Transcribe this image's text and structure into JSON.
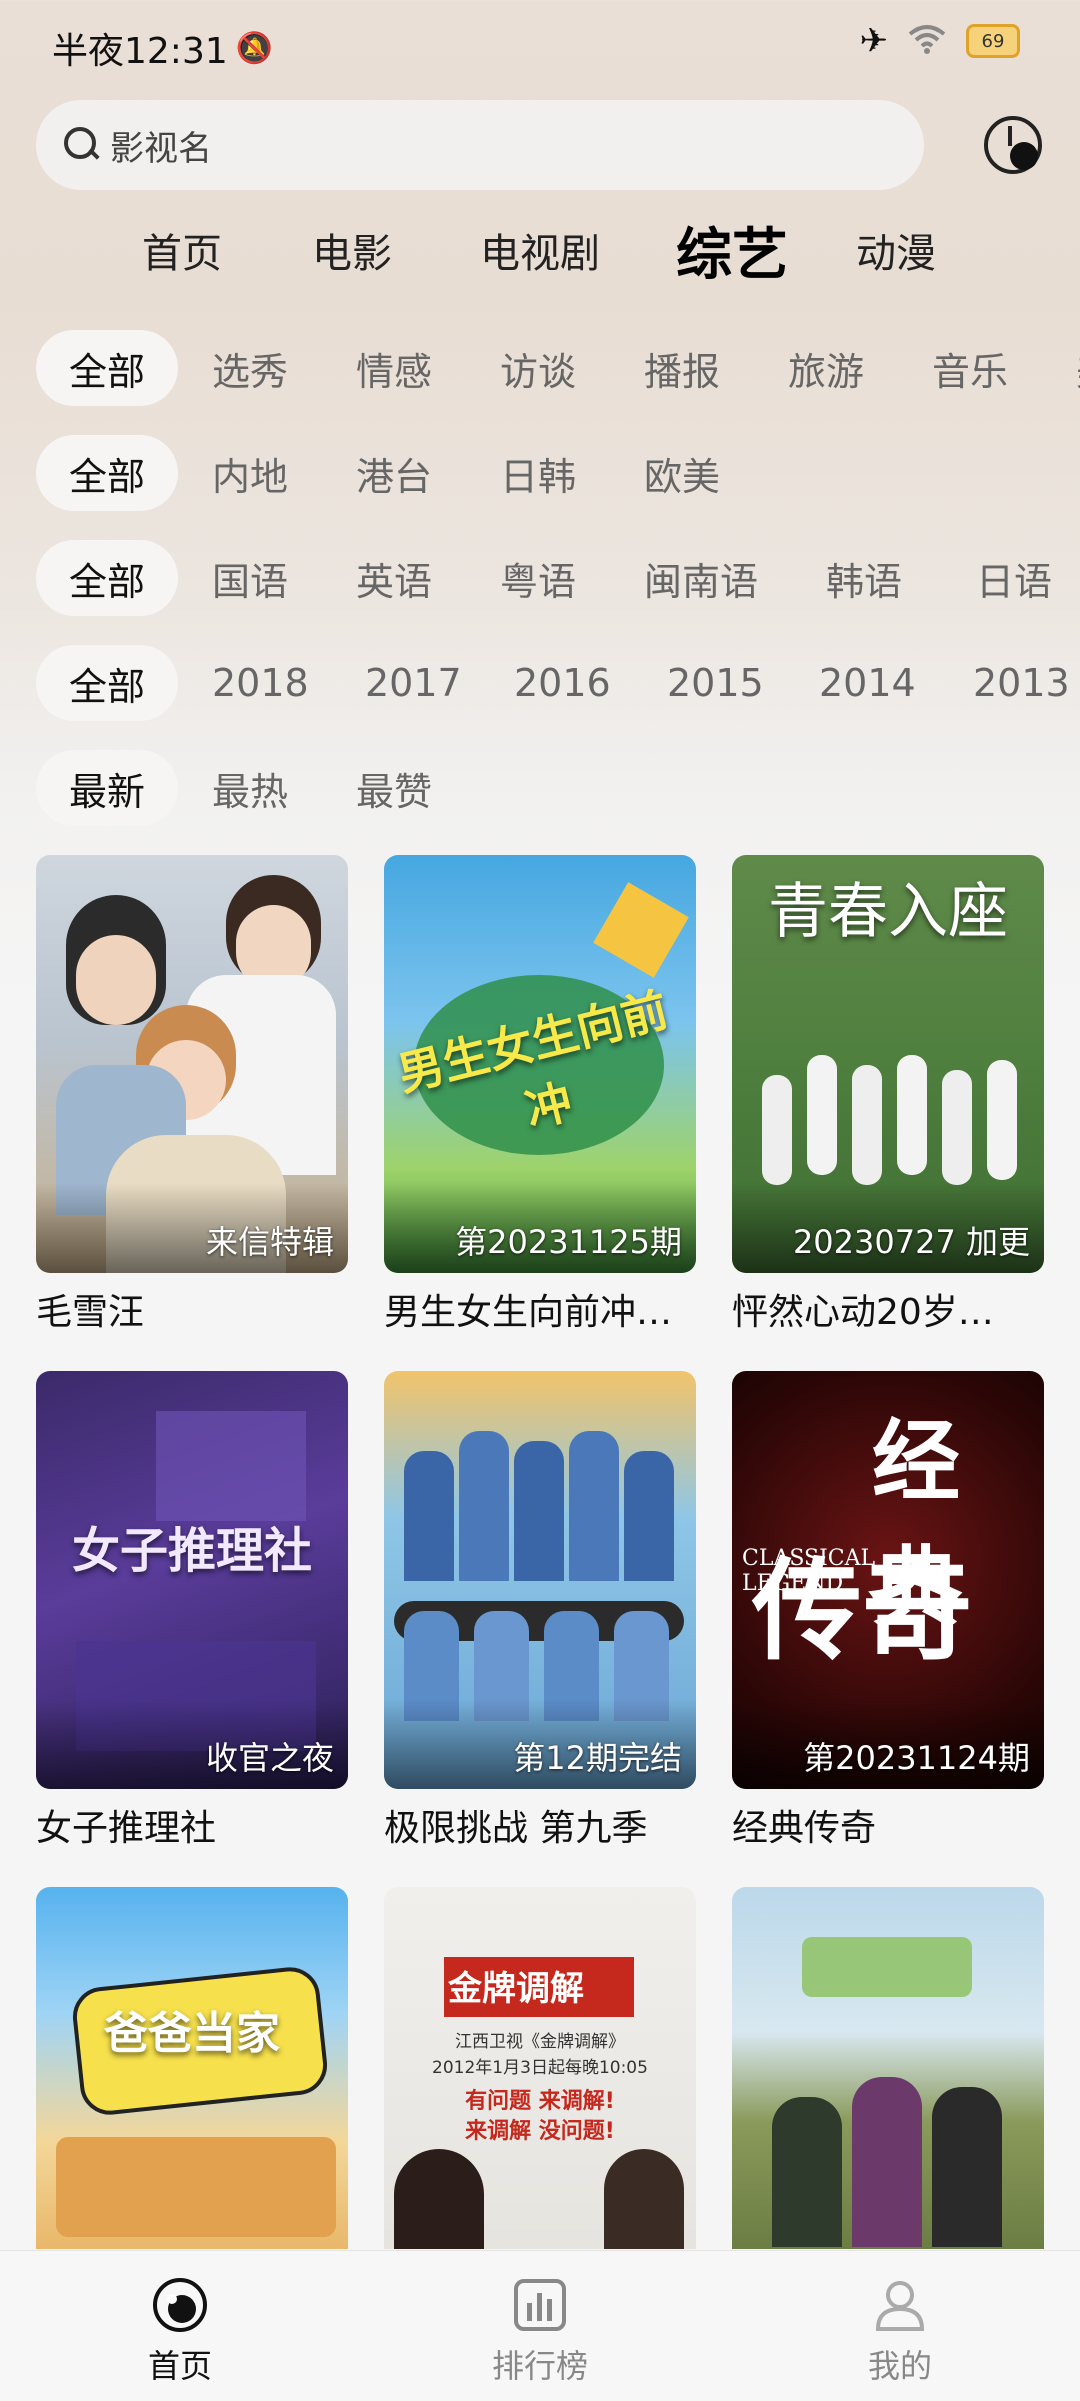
{
  "status_bar": {
    "time": "半夜12:31",
    "battery": "69"
  },
  "search": {
    "placeholder": "影视名"
  },
  "nav_tabs": [
    {
      "label": "首页"
    },
    {
      "label": "电影"
    },
    {
      "label": "电视剧"
    },
    {
      "label": "综艺",
      "active": true
    },
    {
      "label": "动漫"
    }
  ],
  "filters": {
    "type": [
      "全部",
      "选秀",
      "情感",
      "访谈",
      "播报",
      "旅游",
      "音乐",
      "美"
    ],
    "region": [
      "全部",
      "内地",
      "港台",
      "日韩",
      "欧美"
    ],
    "language": [
      "全部",
      "国语",
      "英语",
      "粤语",
      "闽南语",
      "韩语",
      "日语"
    ],
    "year": [
      "全部",
      "2018",
      "2017",
      "2016",
      "2015",
      "2014",
      "2013"
    ],
    "sort": [
      "最新",
      "最热",
      "最赞"
    ]
  },
  "shows": [
    {
      "title": "毛雪汪",
      "badge": "来信特辑"
    },
    {
      "title": "男生女生向前冲…",
      "badge": "第20231125期"
    },
    {
      "title": "怦然心动20岁…",
      "badge": "20230727 加更"
    },
    {
      "title": "女子推理社",
      "badge": "收官之夜"
    },
    {
      "title": "极限挑战 第九季",
      "badge": "第12期完结"
    },
    {
      "title": "经典传奇",
      "badge": "第20231124期"
    },
    {
      "title": "",
      "badge": ""
    },
    {
      "title": "",
      "badge": ""
    },
    {
      "title": "",
      "badge": ""
    }
  ],
  "poster_art": {
    "p2": "男生女生向前冲",
    "p3": "青春入座",
    "p4": "女子推理社",
    "p6a": "经典",
    "p6b": "传奇",
    "p6c": "CLASSICAL LEGEND",
    "p7": "爸爸当家",
    "p8a": "金牌调解",
    "p8b": "江西卫视《金牌调解》",
    "p8c": "2012年1月3日起每晚10:05",
    "p8d": "有问题 来调解!",
    "p8e": "来调解 没问题!"
  },
  "bottom_nav": [
    {
      "label": "首页",
      "icon": "home-icon",
      "active": true
    },
    {
      "label": "排行榜",
      "icon": "chart-icon"
    },
    {
      "label": "我的",
      "icon": "profile-icon"
    }
  ]
}
